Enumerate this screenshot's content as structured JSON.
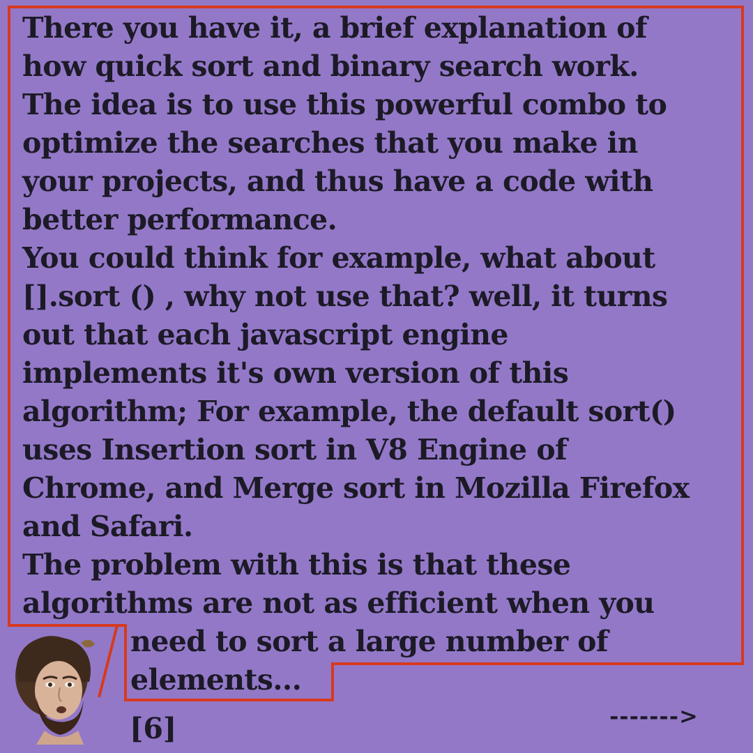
{
  "colors": {
    "background": "#9378c8",
    "border": "#d63a1e",
    "text": "#1c1a26"
  },
  "bubble": {
    "lines": [
      "There you have it, a brief explanation of",
      "how quick sort and binary search work.",
      "The idea is to use this powerful combo to",
      "optimize the searches that you make in",
      "your projects, and thus have a code with",
      "better performance.",
      "You could think for example, what about",
      "[].sort () , why not use that? well, it turns",
      "out that each javascript engine",
      "implements it's own version of this",
      "algorithm; For example, the default sort()",
      "uses Insertion sort in V8 Engine of",
      "Chrome, and Merge sort in Mozilla Firefox",
      "and Safari.",
      "The problem with this is that these",
      "algorithms are not as efficient when you"
    ],
    "tail_lines": [
      "need to sort a large number of",
      "elements..."
    ]
  },
  "avatar": {
    "icon": "person-face-icon"
  },
  "footer": {
    "page_number": "[6]",
    "next_arrow": "------->"
  }
}
